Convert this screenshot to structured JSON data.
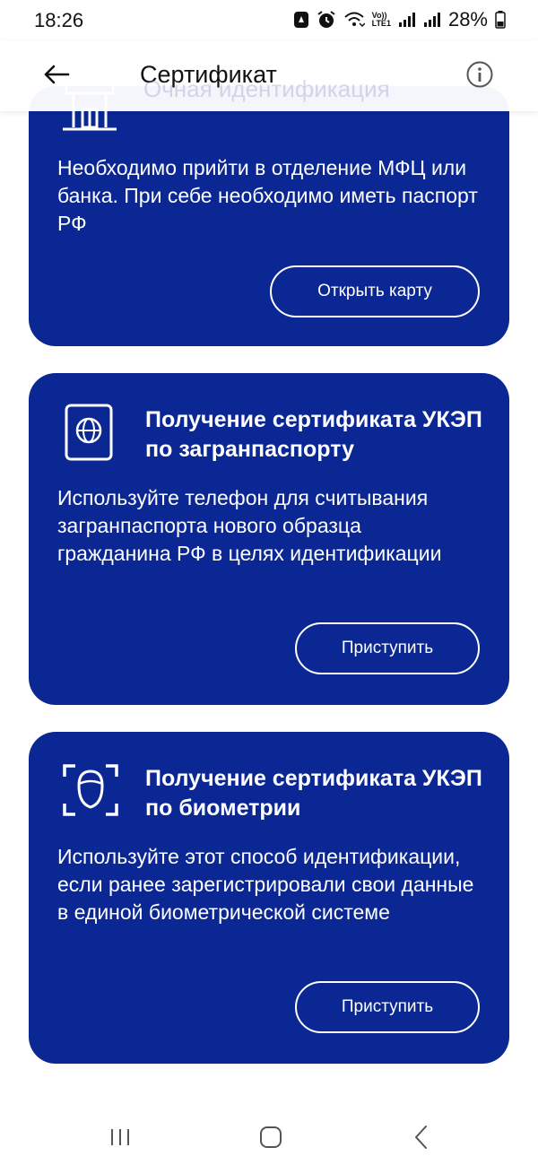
{
  "status_bar": {
    "time": "18:26",
    "battery": "28%",
    "network_top": "Vo))",
    "network_bottom": "LTE1"
  },
  "app_bar": {
    "title": "Сертификат",
    "ghost_title": "Очная идентификация"
  },
  "cards": [
    {
      "icon": "building-icon",
      "text": "Необходимо прийти в отделение МФЦ или банка. При себе необходимо иметь паспорт РФ",
      "button": "Открыть карту"
    },
    {
      "icon": "passport-icon",
      "title": "Получение сертификата УКЭП по загранпаспорту",
      "text": "Используйте телефон для считывания загранпаспорта нового образца гражданина РФ в целях идентификации",
      "button": "Приступить"
    },
    {
      "icon": "face-scan-icon",
      "title": "Получение сертификата УКЭП по биометрии",
      "text": "Используйте этот способ идентификации, если ранее зарегистрировали свои данные в единой биометрической системе",
      "button": "Приступить"
    }
  ],
  "colors": {
    "card_background": "#0a2794",
    "page_background": "#ffffff"
  },
  "nav_bar": {
    "items": [
      "recent-apps-icon",
      "home-icon",
      "back-icon"
    ]
  }
}
